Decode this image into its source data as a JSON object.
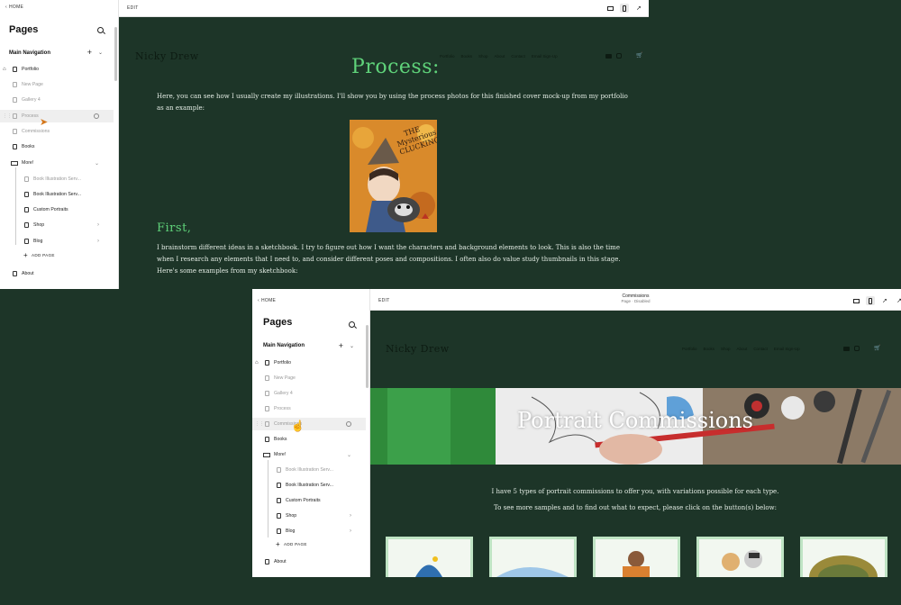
{
  "shot1": {
    "sidebar": {
      "home_label": "HOME",
      "title": "Pages",
      "section": "Main Navigation",
      "items": [
        {
          "label": "Portfolio"
        },
        {
          "label": "New Page"
        },
        {
          "label": "Gallery 4"
        },
        {
          "label": "Process"
        },
        {
          "label": "Commissions"
        },
        {
          "label": "Books"
        },
        {
          "label": "More!"
        },
        {
          "label": "Book Illustration Serv..."
        },
        {
          "label": "Book Illustration Serv..."
        },
        {
          "label": "Custom Portraits"
        },
        {
          "label": "Shop"
        },
        {
          "label": "Blog"
        },
        {
          "label": "ADD PAGE"
        },
        {
          "label": "About"
        }
      ]
    },
    "topbar": {
      "edit_label": "EDIT"
    },
    "site": {
      "logo": "Nicky Drew",
      "nav": [
        "Portfolio",
        "Books",
        "Shop",
        "About",
        "Contact",
        "Email Sign-Up"
      ],
      "heading": "Process:",
      "intro": "Here, you can see how I usually create my illustrations. I'll show you by using the process photos for this finished cover mock-up from my portfolio as an example:",
      "cover_title": "THE Mysterious CLUCKING",
      "subheading": "First,",
      "body": "I brainstorm different ideas in a sketchbook.  I try to figure out how I want the characters and background elements to look.  This is also the time when I research any elements that I need to, and consider different poses and compositions.  I often also do value study thumbnails in this stage.  Here's some examples from my sketchbook:"
    }
  },
  "shot2": {
    "sidebar": {
      "home_label": "HOME",
      "title": "Pages",
      "section": "Main Navigation",
      "items": [
        {
          "label": "Portfolio"
        },
        {
          "label": "New Page"
        },
        {
          "label": "Gallery 4"
        },
        {
          "label": "Process"
        },
        {
          "label": "Commissions"
        },
        {
          "label": "Books"
        },
        {
          "label": "More!"
        },
        {
          "label": "Book Illustration Serv..."
        },
        {
          "label": "Book Illustration Serv..."
        },
        {
          "label": "Custom Portraits"
        },
        {
          "label": "Shop"
        },
        {
          "label": "Blog"
        },
        {
          "label": "ADD PAGE"
        },
        {
          "label": "About"
        }
      ]
    },
    "topbar": {
      "edit_label": "EDIT",
      "page_name": "Commissions",
      "page_status": "Page · Disabled"
    },
    "site": {
      "logo": "Nicky Drew",
      "nav": [
        "Portfolio",
        "Books",
        "Shop",
        "About",
        "Contact",
        "Email Sign-Up"
      ],
      "banner_title": "Portrait Commissions",
      "line1": "I have 5 types of portrait commissions to offer you, with variations possible for each type.",
      "line2": "To see more samples and to find out what to expect, please click on the button(s) below:"
    }
  },
  "colors": {
    "background": "#1d3528",
    "heading_green": "#5fd37a",
    "cursor": "#d4781d"
  },
  "icons": [
    "chevron-left-icon",
    "search-icon",
    "plus-icon",
    "chevron-down-icon",
    "page-icon",
    "home-icon",
    "folder-icon",
    "gear-icon",
    "desktop-icon",
    "mobile-icon",
    "rocket-icon",
    "youtube-icon",
    "instagram-icon",
    "cart-icon",
    "hand-cursor-icon"
  ]
}
